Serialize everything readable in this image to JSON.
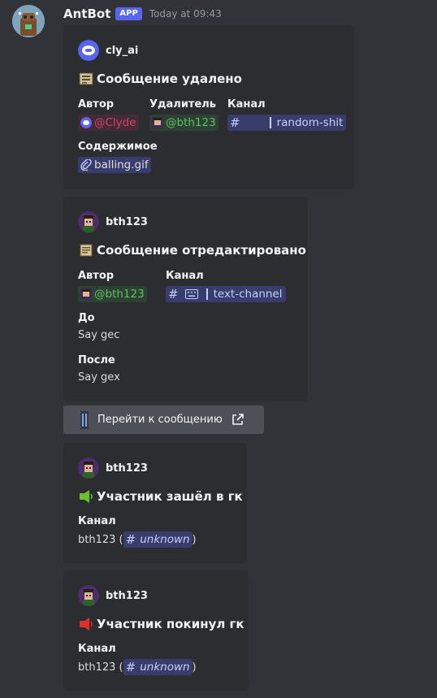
{
  "message": {
    "author": "AntBot",
    "badge": "APP",
    "timestamp": "Today at 09:43"
  },
  "embeds": [
    {
      "author": "cly_ai",
      "title": "Сообщение удалено",
      "fields": {
        "author_label": "Автор",
        "author_value": "@Clyde",
        "deleter_label": "Удалитель",
        "deleter_value": "@bth123",
        "channel_label": "Канал",
        "channel_value": "random-shit",
        "content_label": "Содержимое",
        "content_value": "balling.gif"
      }
    },
    {
      "author": "bth123",
      "title": "Сообщение отредактировано",
      "fields": {
        "author_label": "Автор",
        "author_value": "@bth123",
        "channel_label": "Канал",
        "channel_value": "text-channel",
        "before_label": "До",
        "before_value": "Say gec",
        "after_label": "После",
        "after_value": "Say gex"
      }
    },
    {
      "author": "bth123",
      "title": "Участник зашёл в гк",
      "fields": {
        "channel_label": "Канал",
        "user": "bth123",
        "channel_value": "unknown"
      }
    },
    {
      "author": "bth123",
      "title": "Участник покинул гк",
      "fields": {
        "channel_label": "Канал",
        "user": "bth123",
        "channel_value": "unknown"
      }
    }
  ],
  "jump_button": {
    "label": "Перейти к сообщению"
  },
  "icons": {
    "trash": "trash-icon",
    "scroll": "scroll-icon",
    "join": "speaker-join-icon",
    "leave": "speaker-leave-icon",
    "external": "external-link-icon",
    "attachment": "paperclip-icon",
    "channel": "hash-icon"
  },
  "colors": {
    "background": "#313338",
    "embed": "#2b2d31",
    "badge": "#5865f2",
    "mention_red": "#d2446a",
    "mention_green": "#5ec05e",
    "channel_mention": "#c9cdfb",
    "button": "#4e5058"
  }
}
